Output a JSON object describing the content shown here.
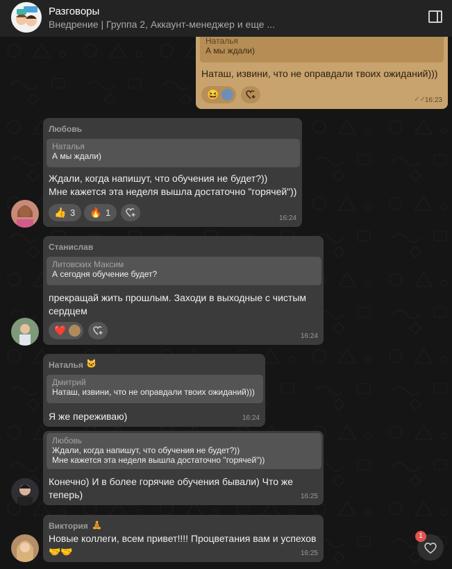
{
  "header": {
    "title": "Разговоры",
    "subtitle": "Внедрение | Группа 2, Аккаунт-менеджер и еще ..."
  },
  "messages": [
    {
      "quote": {
        "name": "Наталья",
        "text": "А мы ждали)"
      },
      "text": "Наташ, извини, что не оправдали твоих ожиданий)))",
      "time": "16:23",
      "status_icon": "double-check-icon",
      "reactions": [
        {
          "emoji": "😆"
        }
      ]
    },
    {
      "sender": "Любовь",
      "quote": {
        "name": "Наталья",
        "text": "А мы ждали)"
      },
      "lines": [
        "Ждали, когда напишут, что обучения не будет?))",
        "Мне кажется эта неделя вышла достаточно \"горячей\"))"
      ],
      "time": "16:24",
      "reactions": [
        {
          "emoji": "👍",
          "count": "3"
        },
        {
          "emoji": "🔥",
          "count": "1"
        }
      ]
    },
    {
      "sender": "Станислав",
      "quote": {
        "name": "Литовских Максим",
        "text": "А сегодня обучение будет?"
      },
      "lines": [
        "прекращай жить прошлым. Заходи в выходные с чистым",
        "сердцем"
      ],
      "time": "16:24",
      "reactions": [
        {
          "emoji": "❤️"
        }
      ]
    },
    {
      "sender": "Наталья",
      "sender_badge": "🐱",
      "quote": {
        "name": "Дмитрий",
        "text": "Наташ, извини, что не оправдали твоих ожиданий)))"
      },
      "text": "Я же переживаю)",
      "time": "16:24"
    },
    {
      "quote": {
        "name": "Любовь",
        "lines": [
          "Ждали, когда напишут, что обучения не будет?))",
          "Мне кажется эта неделя вышла достаточно \"горячей\"))"
        ]
      },
      "lines": [
        "Конечно) И в более горячие обучения бывали) Что же",
        "теперь)"
      ],
      "time": "16:25"
    },
    {
      "sender": "Виктория",
      "sender_badge": "🧘",
      "text": "Новые коллеги, всем привет!!!! Процветания вам и успехов",
      "emoji_line": "🤝🤝",
      "time": "16:25"
    }
  ],
  "fab": {
    "icon": "heart-icon",
    "badge": "1"
  },
  "colors": {
    "background": "#151515",
    "bubble": "#3b3b3b",
    "own_bubble": "#c9a36e",
    "badge": "#e3524f"
  }
}
